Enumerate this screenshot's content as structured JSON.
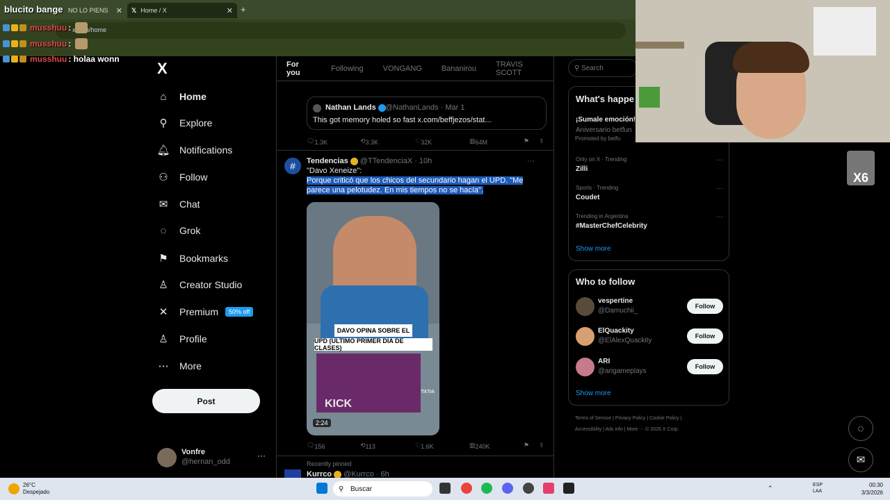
{
  "browser": {
    "tab1_title": "NO LO PIENS",
    "tab2_title": "Home / X",
    "new_tab": "+",
    "close": "✕"
  },
  "overlay": {
    "brand": "blucito bange",
    "chat": [
      {
        "user": "musshuu",
        "msg": ":"
      },
      {
        "user": "musshuu",
        "msg": ":"
      },
      {
        "user": "musshuu",
        "msg": ": holaa wonn"
      }
    ],
    "address_partial": "x.com/home"
  },
  "nav": {
    "logo": "X",
    "items": [
      {
        "label": "Home",
        "icon": "home-icon",
        "glyph": "⌂"
      },
      {
        "label": "Explore",
        "icon": "search-icon",
        "glyph": "⚲"
      },
      {
        "label": "Notifications",
        "icon": "bell-icon",
        "glyph": "🔔︎"
      },
      {
        "label": "Follow",
        "icon": "person-add-icon",
        "glyph": "⚇"
      },
      {
        "label": "Chat",
        "icon": "mail-icon",
        "glyph": "✉"
      },
      {
        "label": "Grok",
        "icon": "grok-icon",
        "glyph": "◌"
      },
      {
        "label": "Bookmarks",
        "icon": "bookmark-icon",
        "glyph": "⚑"
      },
      {
        "label": "Creator Studio",
        "icon": "creator-icon",
        "glyph": "♙"
      },
      {
        "label": "Premium",
        "icon": "x-icon",
        "glyph": "✕"
      },
      {
        "label": "Profile",
        "icon": "person-icon",
        "glyph": "♙"
      },
      {
        "label": "More",
        "icon": "more-icon",
        "glyph": "⋯"
      }
    ],
    "premium_badge": "50% off",
    "post": "Post",
    "account": {
      "name": "Vonfre",
      "handle": "@hernan_odd",
      "menu": "···"
    }
  },
  "feed": {
    "tabs": [
      "For you",
      "Following",
      "VONGANG",
      "Bananirou",
      "TRAVIS SCOTT"
    ],
    "quote": {
      "name": "Nathan Lands",
      "handle": "@NathanLands · Mar 1",
      "text": "This got memory holed so fast x.com/beffjezos/stat..."
    },
    "actions1": {
      "replies": "1.3K",
      "reposts": "3.3K",
      "likes": "32K",
      "views": "64M"
    },
    "tweet": {
      "name": "Tendencias",
      "handle": "@TTendenciaX · 10h",
      "menu": "···",
      "line1": "\"Davo Xeneize\":",
      "selected": "Porque criticó que los chicos del secundario hagan el UPD. \"Me parece una pelotudez. En mis tiempos no se hacía\".",
      "video_caption1": "DAVO OPINA SOBRE EL",
      "video_caption2": "UPD (ULTIMO PRIMER DIA DE CLASES)",
      "video_kick": "KICK",
      "video_tiktok": "TikTok",
      "video_duration": "2:24"
    },
    "actions2": {
      "replies": "156",
      "reposts": "113",
      "likes": "1.6K",
      "views": "240K"
    },
    "pinned_label": "Recently pinned",
    "next": {
      "name": "Kurrco",
      "handle": "@Kurrco · 6h"
    }
  },
  "right": {
    "search_placeholder": "Search",
    "whats_happening": "What's happe",
    "promo": {
      "title": "¡Sumale emoción!",
      "sub": "Aniversario betfun",
      "promoted": "Promoted by betfu"
    },
    "trends": [
      {
        "context": "Only on X · Trending",
        "name": "Zilli"
      },
      {
        "context": "Sports · Trending",
        "name": "Coudet"
      },
      {
        "context": "Trending in Argentina",
        "name": "#MasterChefCelebrity"
      }
    ],
    "show_more": "Show more",
    "who_to_follow": "Who to follow",
    "follow_label": "Follow",
    "suggestions": [
      {
        "name": "vespertine",
        "handle": "@Damuchii_",
        "color": "#5a4a3a"
      },
      {
        "name": "ElQuackity",
        "handle": "@ElAlexQuackity",
        "color": "#d8a070"
      },
      {
        "name": "ARI",
        "handle": "@arigameplays",
        "color": "#c77a8a"
      }
    ],
    "footer_line1": "Terms of Service  |  Privacy Policy  |  Cookie Policy  |",
    "footer_line2": "Accessibility  |  Ads info  |  More ···  © 2026 X Corp.",
    "x6": "X6"
  },
  "taskbar": {
    "temp": "26°C",
    "condition": "Despejado",
    "search": "Buscar",
    "lang1": "ESP",
    "lang2": "LAA",
    "time": "00:30",
    "date": "3/3/2026"
  }
}
